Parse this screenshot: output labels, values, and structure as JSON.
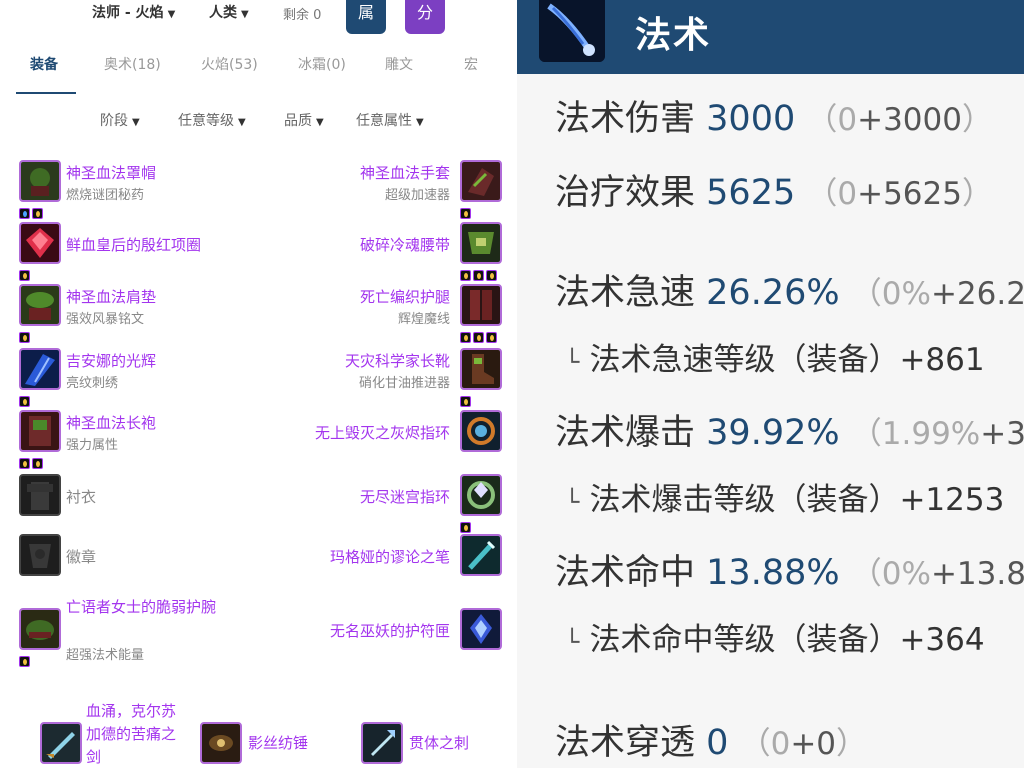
{
  "topbar": {
    "class_spec": "法师 - 火焰",
    "race": "人类",
    "remaining": "剩余 0",
    "attr_button": "属",
    "score_button": "分"
  },
  "tabs": [
    {
      "label": "装备",
      "active": true
    },
    {
      "label": "奥术(18)",
      "active": false
    },
    {
      "label": "火焰(53)",
      "active": false
    },
    {
      "label": "冰霜(0)",
      "active": false
    },
    {
      "label": "雕文",
      "active": false
    },
    {
      "label": "宏",
      "active": false
    }
  ],
  "filters": [
    "阶段",
    "任意等级",
    "品质",
    "任意属性"
  ],
  "gear_left": [
    {
      "name": "神圣血法罩帽",
      "sub": "燃烧谜团秘药",
      "gems": [
        "blue",
        "gold"
      ]
    },
    {
      "name": "鲜血皇后的殷红项圈",
      "sub": "",
      "gems": [
        "gold"
      ]
    },
    {
      "name": "神圣血法肩垫",
      "sub": "强效风暴铭文",
      "gems": [
        "gold"
      ]
    },
    {
      "name": "吉安娜的光辉",
      "sub": "亮纹刺绣",
      "gems": [
        "gold"
      ]
    },
    {
      "name": "神圣血法长袍",
      "sub": "强力属性",
      "gems": [
        "gold",
        "gold"
      ]
    },
    {
      "name": "衬衣",
      "sub": "",
      "gems": [],
      "empty": true
    },
    {
      "name": "徽章",
      "sub": "",
      "gems": [],
      "empty": true
    },
    {
      "name": "亡语者女士的脆弱护腕",
      "sub": "超强法术能量",
      "gems": [
        "gold"
      ]
    }
  ],
  "gear_right": [
    {
      "name": "神圣血法手套",
      "sub": "超级加速器",
      "gems": [
        "gold"
      ]
    },
    {
      "name": "破碎冷魂腰带",
      "sub": "",
      "gems": [
        "gold",
        "gold",
        "gold"
      ]
    },
    {
      "name": "死亡编织护腿",
      "sub": "辉煌魔线",
      "gems": [
        "gold",
        "gold",
        "gold"
      ]
    },
    {
      "name": "天灾科学家长靴",
      "sub": "硝化甘油推进器",
      "gems": [
        "gold"
      ]
    },
    {
      "name": "无上毁灭之灰烬指环",
      "sub": "",
      "gems": []
    },
    {
      "name": "无尽迷宫指环",
      "sub": "",
      "gems": [
        "gold"
      ]
    },
    {
      "name": "玛格娅的谬论之笔",
      "sub": "",
      "gems": []
    },
    {
      "name": "无名巫妖的护符匣",
      "sub": "",
      "gems": []
    }
  ],
  "weapons": {
    "main": "血涌，克尔苏加德的苦痛之剑",
    "off": "影丝纺锤",
    "ranged": "贯体之刺"
  },
  "right_panel": {
    "title": "法术",
    "stats": [
      {
        "label": "法术伤害",
        "value": "3000",
        "open": "（",
        "base": "0",
        "plus": "+3000",
        "close": "）"
      },
      {
        "label": "治疗效果",
        "value": "5625",
        "open": "（",
        "base": "0",
        "plus": "+5625",
        "close": "）"
      },
      {
        "label": "法术急速",
        "value": "26.26%",
        "open": "（",
        "base": "0%",
        "plus": "+26.2",
        "close": ""
      },
      {
        "label": "法术爆击",
        "value": "39.92%",
        "open": "（",
        "base": "1.99%",
        "plus": "+3",
        "close": ""
      },
      {
        "label": "法术命中",
        "value": "13.88%",
        "open": "（",
        "base": "0%",
        "plus": "+13.8",
        "close": ""
      },
      {
        "label": "法术穿透",
        "value": "0",
        "open": "（",
        "base": "0",
        "plus": "+0",
        "close": "）"
      }
    ],
    "sub_stats": [
      {
        "corner": "└",
        "text": "法术急速等级（装备）+861"
      },
      {
        "corner": "└",
        "text": "法术爆击等级（装备）+1253"
      },
      {
        "corner": "└",
        "text": "法术命中等级（装备）+364"
      }
    ]
  },
  "colors": {
    "epic": "#a335ee",
    "header": "#1f4a73",
    "score_button": "#7c3fc2"
  }
}
